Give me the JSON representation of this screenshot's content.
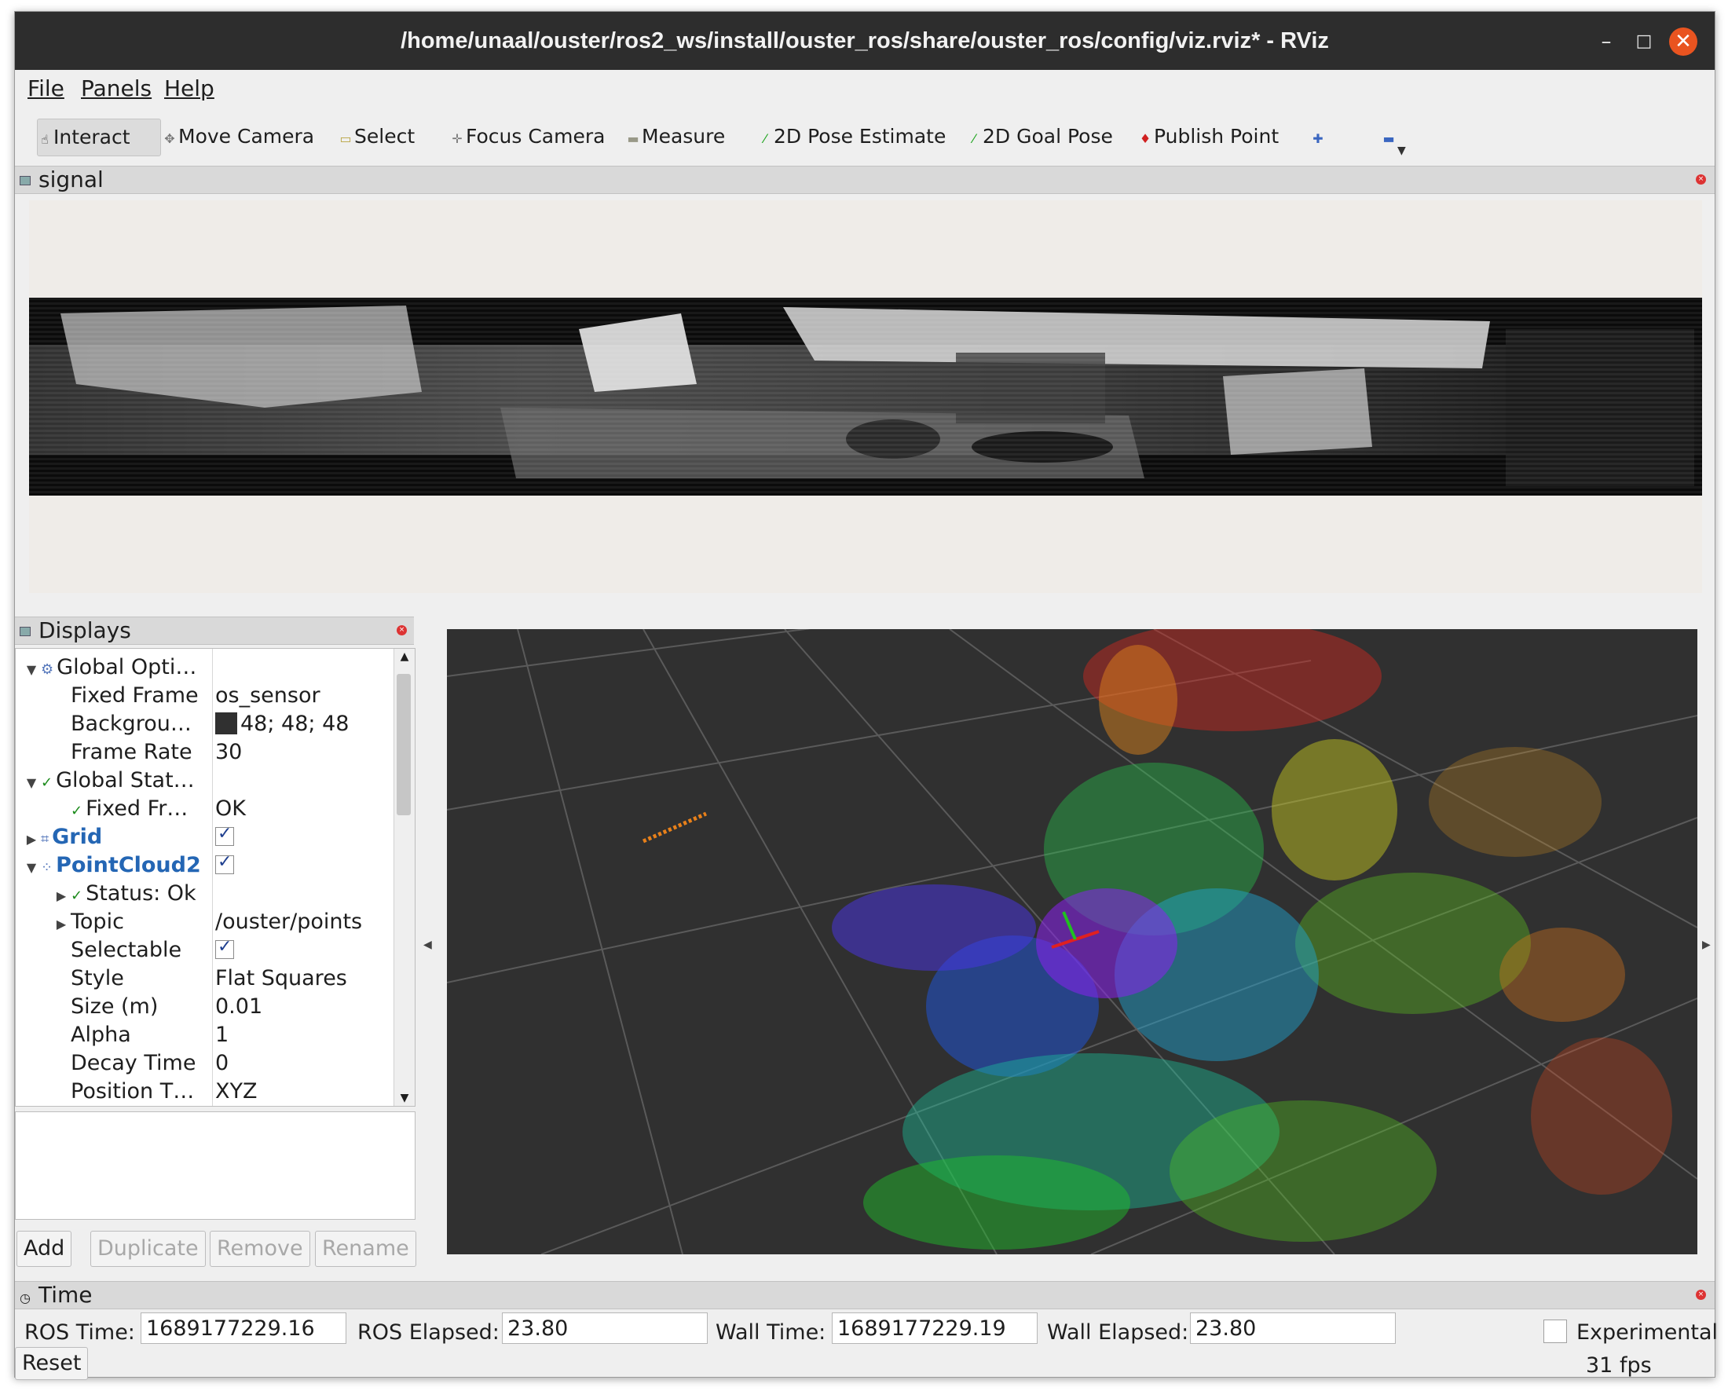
{
  "window": {
    "title": "/home/unaal/ouster/ros2_ws/install/ouster_ros/share/ouster_ros/config/viz.rviz* - RViz"
  },
  "menu": [
    "File",
    "Panels",
    "Help"
  ],
  "toolbar": {
    "tools": [
      {
        "label": "Interact",
        "icon": "hand-pointer-icon"
      },
      {
        "label": "Move Camera",
        "icon": "move-camera-icon"
      },
      {
        "label": "Select",
        "icon": "select-rect-icon"
      },
      {
        "label": "Focus Camera",
        "icon": "focus-camera-icon"
      },
      {
        "label": "Measure",
        "icon": "ruler-icon"
      },
      {
        "label": "2D Pose Estimate",
        "icon": "green-arrow-icon"
      },
      {
        "label": "2D Goal Pose",
        "icon": "green-arrow-icon"
      },
      {
        "label": "Publish Point",
        "icon": "red-pin-icon"
      }
    ],
    "add_tool_icon": "plus-icon",
    "remove_tool_icon": "minus-icon"
  },
  "signal_panel": {
    "title": "signal"
  },
  "displays_panel": {
    "title": "Displays",
    "rows": [
      {
        "name": "Global Opti…",
        "value": "",
        "arrow": "▼",
        "icon": "gear",
        "style": "normal"
      },
      {
        "name": "Fixed Frame",
        "value": "os_sensor",
        "arrow": "",
        "icon": "",
        "style": "normal"
      },
      {
        "name": "Backgrou…",
        "value": "48; 48; 48",
        "arrow": "",
        "icon": "",
        "style": "normal",
        "swatch": "#303030"
      },
      {
        "name": "Frame Rate",
        "value": "30",
        "arrow": "",
        "icon": "",
        "style": "normal"
      },
      {
        "name": "Global Stat…",
        "value": "",
        "arrow": "▼",
        "icon": "check",
        "style": "normal"
      },
      {
        "name": "Fixed Fr…",
        "value": "OK",
        "arrow": "",
        "icon": "check",
        "style": "normal"
      },
      {
        "name": "Grid",
        "value": "",
        "arrow": "▶",
        "icon": "grid",
        "style": "blue",
        "checkbox": true
      },
      {
        "name": "PointCloud2",
        "value": "",
        "arrow": "▼",
        "icon": "cloud",
        "style": "blue",
        "checkbox": true
      },
      {
        "name": "Status: Ok",
        "value": "",
        "arrow": "▶",
        "icon": "check",
        "style": "normal"
      },
      {
        "name": "Topic",
        "value": "/ouster/points",
        "arrow": "▶",
        "icon": "",
        "style": "normal"
      },
      {
        "name": "Selectable",
        "value": "",
        "arrow": "",
        "icon": "",
        "style": "normal",
        "checkbox": true
      },
      {
        "name": "Style",
        "value": "Flat Squares",
        "arrow": "",
        "icon": "",
        "style": "normal"
      },
      {
        "name": "Size (m)",
        "value": "0.01",
        "arrow": "",
        "icon": "",
        "style": "normal"
      },
      {
        "name": "Alpha",
        "value": "1",
        "arrow": "",
        "icon": "",
        "style": "normal"
      },
      {
        "name": "Decay Time",
        "value": "0",
        "arrow": "",
        "icon": "",
        "style": "normal"
      },
      {
        "name": "Position T…",
        "value": "XYZ",
        "arrow": "",
        "icon": "",
        "style": "normal"
      }
    ],
    "buttons": {
      "add": "Add",
      "duplicate": "Duplicate",
      "remove": "Remove",
      "rename": "Rename"
    }
  },
  "time_panel": {
    "title": "Time",
    "ros_time_label": "ROS Time:",
    "ros_time": "1689177229.16",
    "ros_elapsed_label": "ROS Elapsed:",
    "ros_elapsed": "23.80",
    "wall_time_label": "Wall Time:",
    "wall_time": "1689177229.19",
    "wall_elapsed_label": "Wall Elapsed:",
    "wall_elapsed": "23.80",
    "experimental": "Experimental",
    "reset": "Reset",
    "fps": "31 fps"
  },
  "colors": {
    "viewport_bg": "#303030",
    "blue_label": "#2466b4",
    "close_orange": "#e95420"
  }
}
